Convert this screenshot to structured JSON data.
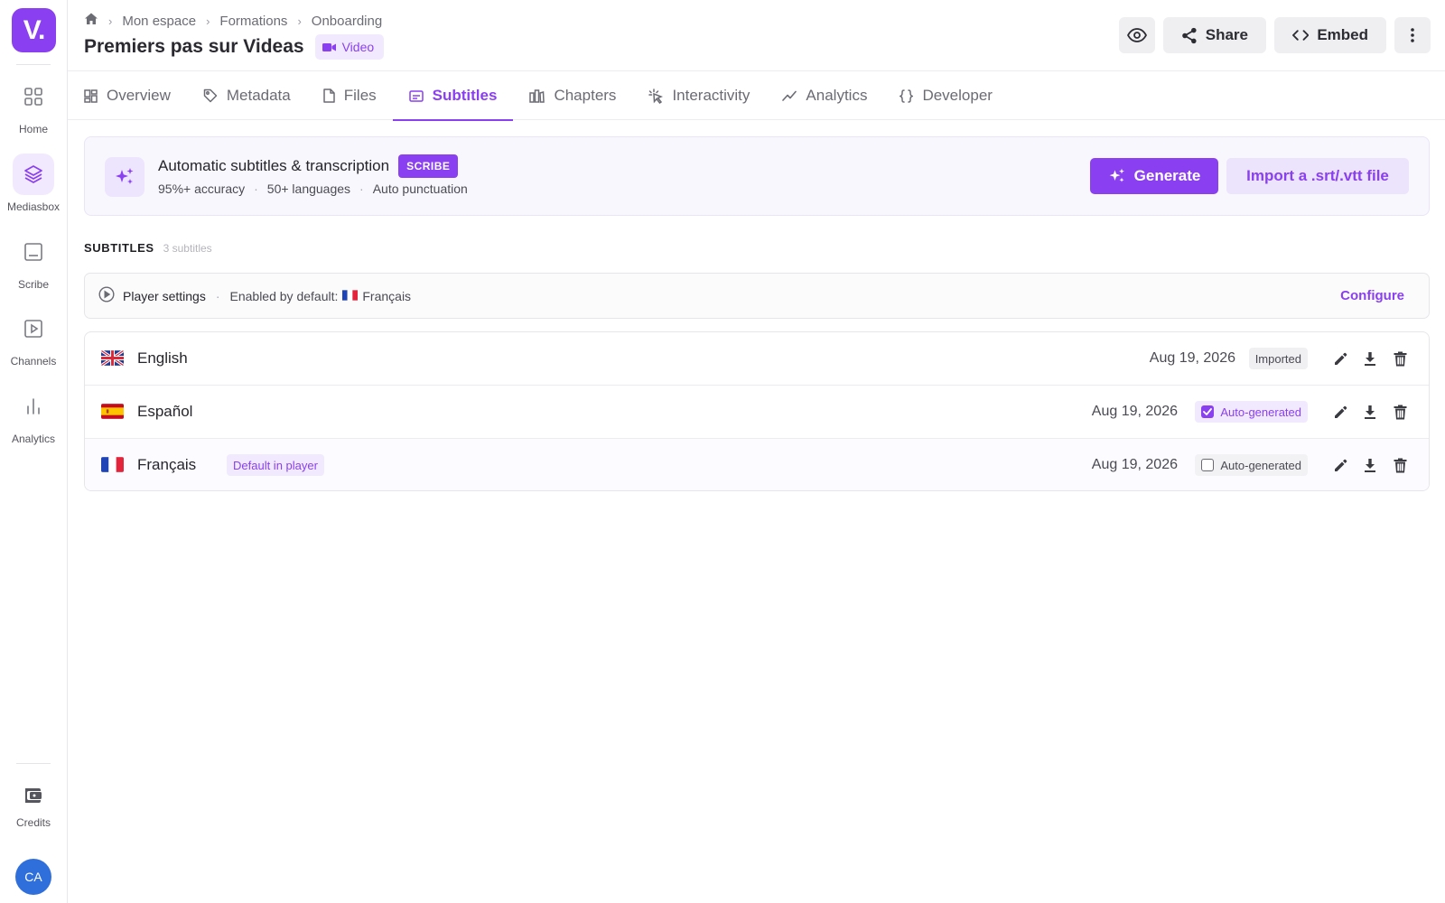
{
  "app": {
    "logo_text": "V.",
    "avatar_initials": "CA",
    "accent_color": "#8a3ff0"
  },
  "sidebar": {
    "items": [
      {
        "label": "Home",
        "icon": "grid-icon"
      },
      {
        "label": "Mediasbox",
        "icon": "layers-icon",
        "active": true
      },
      {
        "label": "Scribe",
        "icon": "caption-icon"
      },
      {
        "label": "Channels",
        "icon": "play-square-icon"
      },
      {
        "label": "Analytics",
        "icon": "bar-chart-icon"
      }
    ],
    "credits_label": "Credits"
  },
  "breadcrumb": [
    "Mon espace",
    "Formations",
    "Onboarding"
  ],
  "header": {
    "title": "Premiers pas sur Videas",
    "type_badge": "Video",
    "share_label": "Share",
    "embed_label": "Embed"
  },
  "tabs": [
    {
      "label": "Overview",
      "icon": "dashboard-icon"
    },
    {
      "label": "Metadata",
      "icon": "tag-icon"
    },
    {
      "label": "Files",
      "icon": "file-icon"
    },
    {
      "label": "Subtitles",
      "icon": "subtitles-icon",
      "active": true
    },
    {
      "label": "Chapters",
      "icon": "chapters-icon"
    },
    {
      "label": "Interactivity",
      "icon": "click-icon"
    },
    {
      "label": "Analytics",
      "icon": "trend-icon"
    },
    {
      "label": "Developer",
      "icon": "braces-icon"
    }
  ],
  "scribe_banner": {
    "title": "Automatic subtitles & transcription",
    "badge": "SCRIBE",
    "features": [
      "95%+ accuracy",
      "50+ languages",
      "Auto punctuation"
    ],
    "generate_label": "Generate",
    "import_label": "Import a .srt/.vtt file"
  },
  "subtitles_section": {
    "heading": "SUBTITLES",
    "count": "3 subtitles"
  },
  "player_settings": {
    "label": "Player settings",
    "default_prefix": "Enabled by default:",
    "default_language": "Français",
    "configure_label": "Configure"
  },
  "subtitles": [
    {
      "language": "English",
      "flag": "uk",
      "date": "Aug 19, 2026",
      "tag": "Imported",
      "tag_type": "imported"
    },
    {
      "language": "Español",
      "flag": "es",
      "date": "Aug 19, 2026",
      "tag": "Auto-generated",
      "tag_type": "auto-on"
    },
    {
      "language": "Français",
      "flag": "fr",
      "date": "Aug 19, 2026",
      "tag": "Auto-generated",
      "tag_type": "auto-off",
      "default_badge": "Default in player"
    }
  ]
}
